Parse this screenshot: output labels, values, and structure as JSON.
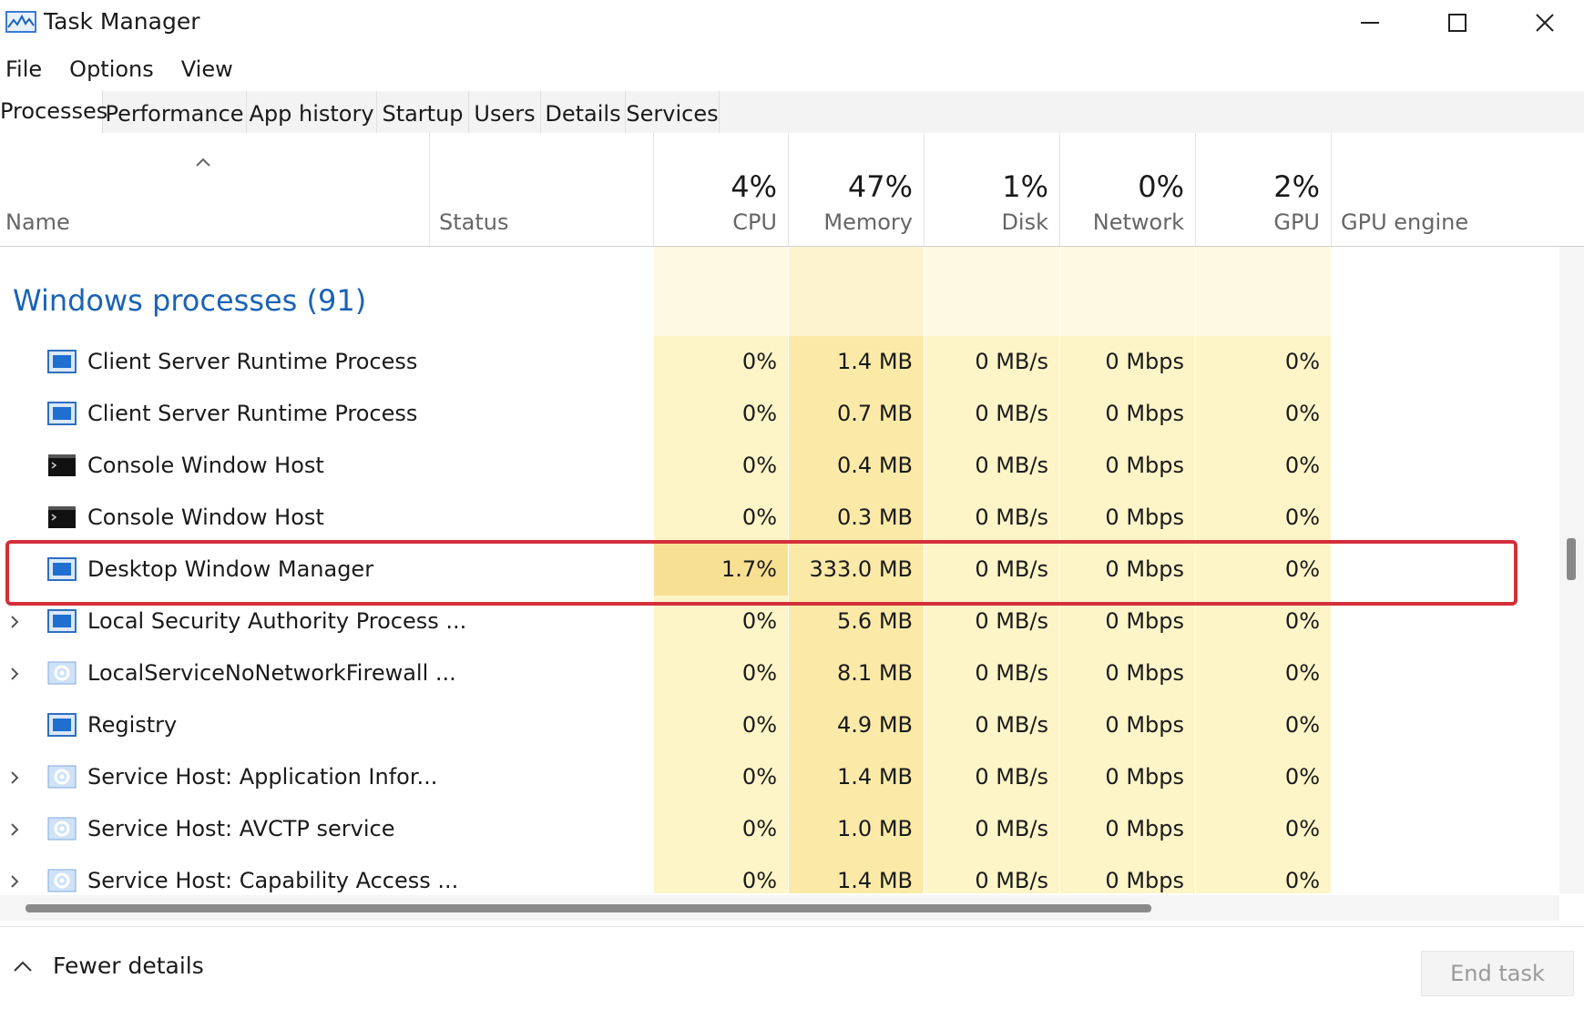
{
  "window": {
    "title": "Task Manager"
  },
  "menu": [
    "File",
    "Options",
    "View"
  ],
  "tabs": [
    {
      "label": "Processes",
      "active": true
    },
    {
      "label": "Performance"
    },
    {
      "label": "App history"
    },
    {
      "label": "Startup"
    },
    {
      "label": "Users"
    },
    {
      "label": "Details"
    },
    {
      "label": "Services"
    }
  ],
  "columns": {
    "name": "Name",
    "status": "Status",
    "cpu": {
      "pct": "4%",
      "label": "CPU"
    },
    "memory": {
      "pct": "47%",
      "label": "Memory"
    },
    "disk": {
      "pct": "1%",
      "label": "Disk"
    },
    "network": {
      "pct": "0%",
      "label": "Network"
    },
    "gpu": {
      "pct": "2%",
      "label": "GPU"
    },
    "gpu_engine": "GPU engine"
  },
  "group": {
    "title": "Windows processes (91)"
  },
  "processes": [
    {
      "name": "Client Server Runtime Process",
      "icon": "window-icon",
      "expandable": false,
      "cpu": "0%",
      "memory": "1.4 MB",
      "disk": "0 MB/s",
      "network": "0 Mbps",
      "gpu": "0%"
    },
    {
      "name": "Client Server Runtime Process",
      "icon": "window-icon",
      "expandable": false,
      "cpu": "0%",
      "memory": "0.7 MB",
      "disk": "0 MB/s",
      "network": "0 Mbps",
      "gpu": "0%"
    },
    {
      "name": "Console Window Host",
      "icon": "console-icon",
      "expandable": false,
      "cpu": "0%",
      "memory": "0.4 MB",
      "disk": "0 MB/s",
      "network": "0 Mbps",
      "gpu": "0%"
    },
    {
      "name": "Console Window Host",
      "icon": "console-icon",
      "expandable": false,
      "cpu": "0%",
      "memory": "0.3 MB",
      "disk": "0 MB/s",
      "network": "0 Mbps",
      "gpu": "0%"
    },
    {
      "name": "Desktop Window Manager",
      "icon": "window-icon",
      "expandable": false,
      "highlighted": true,
      "cpu": "1.7%",
      "memory": "333.0 MB",
      "disk": "0 MB/s",
      "network": "0 Mbps",
      "gpu": "0%"
    },
    {
      "name": "Local Security Authority Process ...",
      "icon": "window-icon",
      "expandable": true,
      "cpu": "0%",
      "memory": "5.6 MB",
      "disk": "0 MB/s",
      "network": "0 Mbps",
      "gpu": "0%"
    },
    {
      "name": "LocalServiceNoNetworkFirewall ...",
      "icon": "gear-icon",
      "expandable": true,
      "cpu": "0%",
      "memory": "8.1 MB",
      "disk": "0 MB/s",
      "network": "0 Mbps",
      "gpu": "0%"
    },
    {
      "name": "Registry",
      "icon": "window-icon",
      "expandable": false,
      "cpu": "0%",
      "memory": "4.9 MB",
      "disk": "0 MB/s",
      "network": "0 Mbps",
      "gpu": "0%"
    },
    {
      "name": "Service Host: Application Infor...",
      "icon": "gear-icon",
      "expandable": true,
      "cpu": "0%",
      "memory": "1.4 MB",
      "disk": "0 MB/s",
      "network": "0 Mbps",
      "gpu": "0%"
    },
    {
      "name": "Service Host: AVCTP service",
      "icon": "gear-icon",
      "expandable": true,
      "cpu": "0%",
      "memory": "1.0 MB",
      "disk": "0 MB/s",
      "network": "0 Mbps",
      "gpu": "0%"
    },
    {
      "name": "Service Host: Capability Access ...",
      "icon": "gear-icon",
      "expandable": true,
      "cpu": "0%",
      "memory": "1.4 MB",
      "disk": "0 MB/s",
      "network": "0 Mbps",
      "gpu": "0%"
    }
  ],
  "footer": {
    "fewer_details": "Fewer details",
    "end_task": "End task"
  },
  "colors": {
    "heat_light": "#fdf4c8",
    "heat_mid": "#fbeaa7",
    "heat_strong": "#f8e093",
    "group_blue": "#1a63b5",
    "highlight_red": "#d32f3a"
  }
}
